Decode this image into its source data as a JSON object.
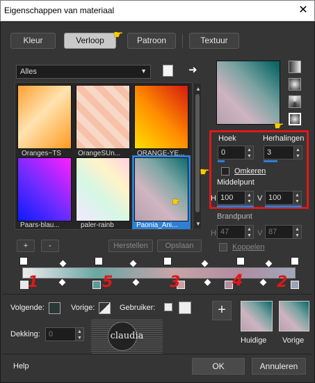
{
  "window": {
    "title": "Eigenschappen van materiaal",
    "close_icon": "close-icon"
  },
  "tabs": [
    {
      "label": "Kleur",
      "active": false
    },
    {
      "label": "Verloop",
      "active": true
    },
    {
      "label": "Patroon",
      "active": false
    },
    {
      "label": "Textuur",
      "active": false
    }
  ],
  "category_select": {
    "value": "Alles"
  },
  "presets": [
    {
      "label": "Oranges~TS"
    },
    {
      "label": "OrangeSUn..."
    },
    {
      "label": "ORANGE-YE..."
    },
    {
      "label": "Paars-blau..."
    },
    {
      "label": "paler-rainb"
    },
    {
      "label": "Paonia_Ani...",
      "selected": true
    }
  ],
  "preset_buttons": {
    "add": "+",
    "remove": "-",
    "restore": "Herstellen",
    "save": "Opslaan"
  },
  "angle": {
    "label": "Hoek",
    "value": "0"
  },
  "repeats": {
    "label": "Herhalingen",
    "value": "3"
  },
  "invert": {
    "label": "Omkeren",
    "checked": false
  },
  "midpoint": {
    "label": "Middelpunt",
    "h_label": "H",
    "h_value": "100",
    "v_label": "V",
    "v_value": "100"
  },
  "focal": {
    "label": "Brandpunt",
    "h_label": "H",
    "h_value": "47",
    "v_label": "V",
    "v_value": "87"
  },
  "link": {
    "label": "Koppelen",
    "checked": false
  },
  "gradient_stops": {
    "numbers": [
      "1",
      "5",
      "3",
      "4",
      "2"
    ],
    "colors": [
      "#e8e8e8",
      "#5a9a98",
      "#caa0a4",
      "#b28ea0",
      "#9aa4b8"
    ]
  },
  "bottom": {
    "next_label": "Volgende:",
    "prev_label": "Vorige:",
    "user_label": "Gebruiker:",
    "opacity_label": "Dekking:",
    "opacity_value": "0",
    "current_label": "Huidige",
    "previous_label": "Vorige",
    "watermark": "claudia"
  },
  "footer": {
    "help": "Help",
    "ok": "OK",
    "cancel": "Annuleren"
  },
  "colors": {
    "accent_red": "#e01818",
    "selection_blue": "#2e7fd6"
  }
}
